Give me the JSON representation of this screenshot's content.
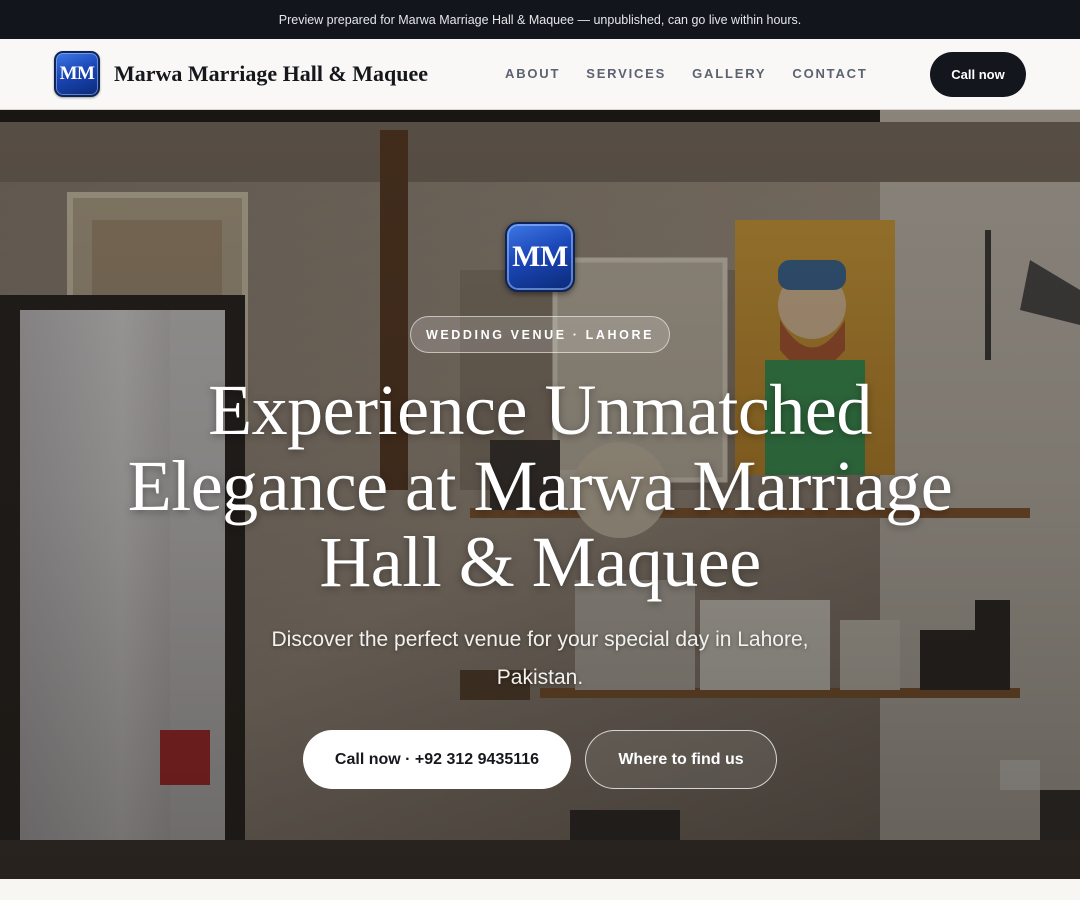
{
  "preview_bar": {
    "text": "Preview prepared for Marwa Marriage Hall & Maquee — unpublished, can go live within hours."
  },
  "nav": {
    "logo_initials": "MM",
    "brand_name": "Marwa Marriage Hall & Maquee",
    "links": [
      {
        "label": "ABOUT"
      },
      {
        "label": "SERVICES"
      },
      {
        "label": "GALLERY"
      },
      {
        "label": "CONTACT"
      }
    ],
    "cta_label": "Call now"
  },
  "hero": {
    "badge_initials": "MM",
    "pill_text": "WEDDING VENUE · LAHORE",
    "title": "Experience Unmatched Elegance at Marwa Marriage Hall & Maquee",
    "subtitle": "Discover the perfect venue for your special day in Lahore, Pakistan.",
    "primary_button": "Call now · +92 312 9435116",
    "secondary_button": "Where to find us"
  },
  "colors": {
    "preview_bar_bg": "#12151b",
    "nav_bg": "#faf8f6",
    "logo_blue": "#1b47b8",
    "cta_dark": "#13161c"
  }
}
